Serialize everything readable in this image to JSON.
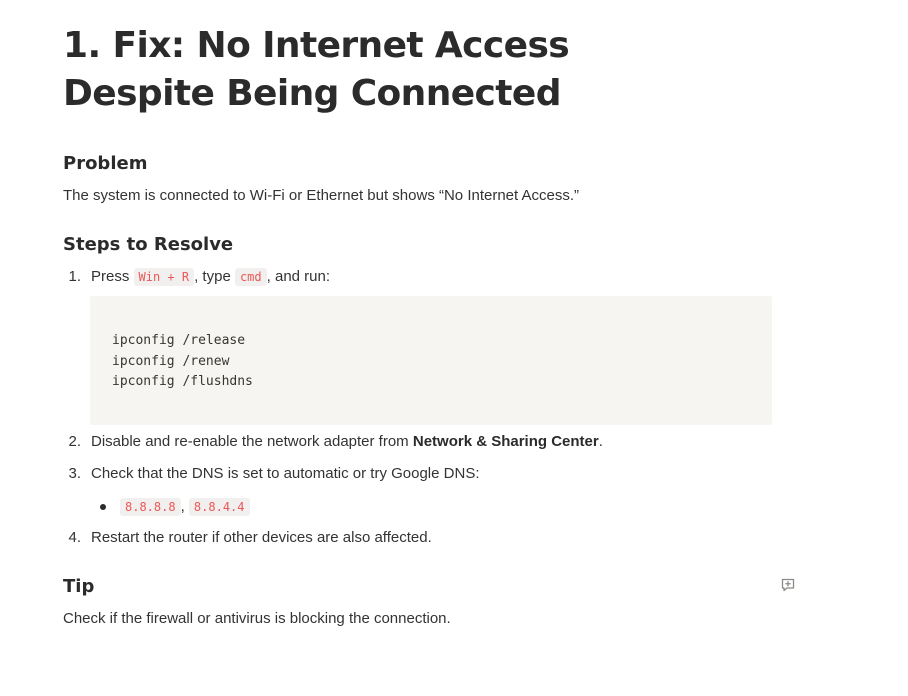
{
  "title": "1. Fix: No Internet Access Despite Being Connected",
  "problem": {
    "heading": "Problem",
    "text": "The system is connected to Wi-Fi or Ethernet but shows “No Internet Access.”"
  },
  "steps": {
    "heading": "Steps to Resolve",
    "step1": {
      "num": "1.",
      "press": "Press",
      "key": "Win + R",
      "type": ", type",
      "cmd": "cmd",
      "run": ", and run:"
    },
    "code": [
      "ipconfig /release",
      "ipconfig /renew",
      "ipconfig /flushdns"
    ],
    "step2": {
      "num": "2.",
      "text": "Disable and re-enable the network adapter from",
      "bold": "Network & Sharing Center",
      "end": "."
    },
    "step3": {
      "num": "3.",
      "text": "Check that the DNS is set to automatic or try Google DNS:"
    },
    "dns": {
      "primary": "8.8.8.8",
      "sep": ",",
      "secondary": "8.8.4.4"
    },
    "step4": {
      "num": "4.",
      "text": "Restart the router if other devices are also affected."
    }
  },
  "tip": {
    "heading": "Tip",
    "text": "Check if the firewall or antivirus is blocking the connection."
  },
  "icons": {
    "comment": "add-comment-icon"
  }
}
